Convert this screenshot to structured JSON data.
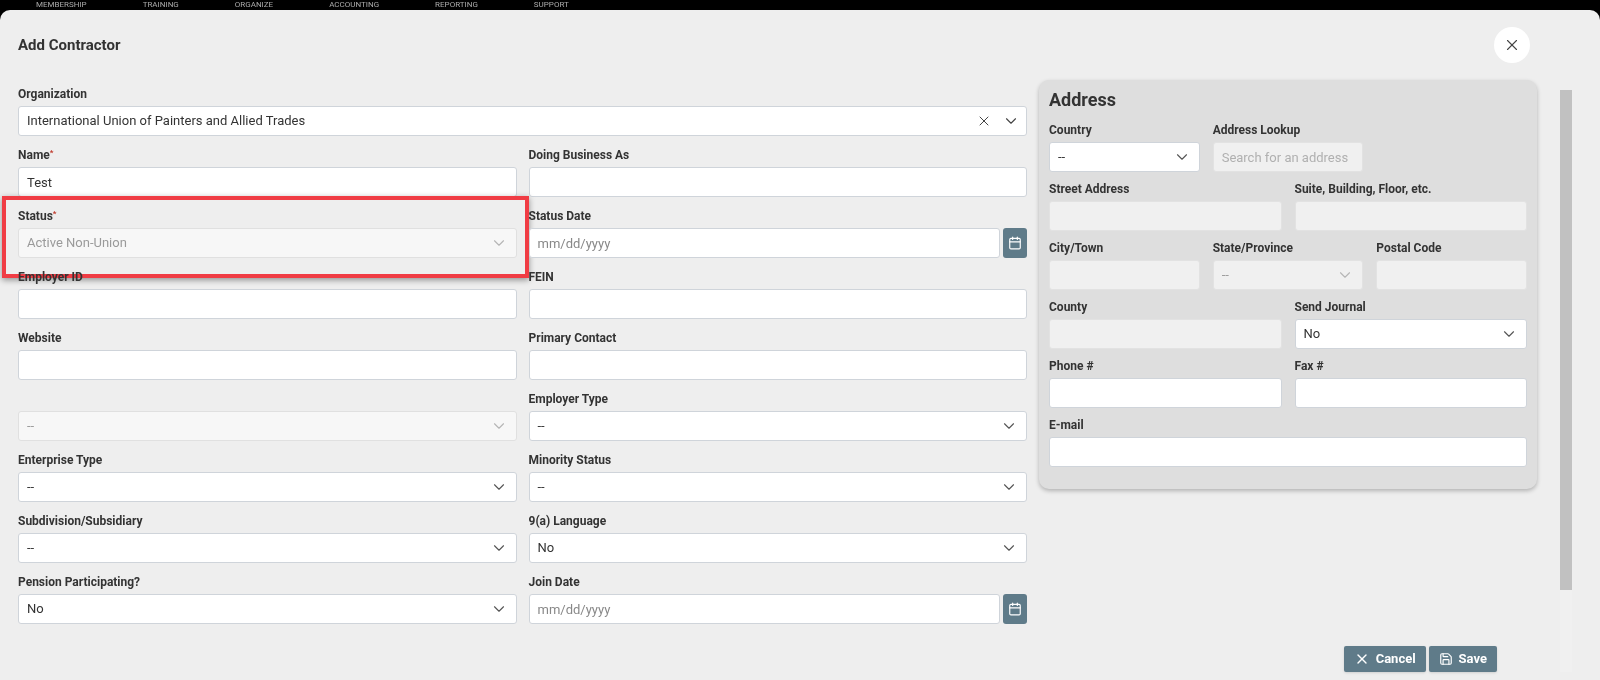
{
  "nav": [
    "MEMBERSHIP",
    "TRAINING",
    "ORGANIZE",
    "ACCOUNTING",
    "REPORTING",
    "SUPPORT"
  ],
  "dialog": {
    "title": "Add Contractor"
  },
  "organization": {
    "label": "Organization",
    "value": "International Union of Painters and Allied Trades"
  },
  "fields": [
    {
      "label": "Name",
      "required_mark": "*",
      "kind": "text",
      "value": "Test",
      "disabled": false
    },
    {
      "label": "Doing Business As",
      "kind": "text",
      "disabled": false
    },
    {
      "label": "Status",
      "required_mark": "*",
      "kind": "select",
      "value": "Active Non-Union",
      "disabled": true,
      "highlighted": true
    },
    {
      "label": "Status Date",
      "kind": "date",
      "placeholder": "mm/dd/yyyy",
      "disabled": false
    },
    {
      "label": "Employer ID",
      "kind": "text",
      "disabled": false
    },
    {
      "label": "FEIN",
      "kind": "text",
      "disabled": false
    },
    {
      "label": "Website",
      "kind": "text",
      "disabled": false
    },
    {
      "label": "Primary Contact",
      "kind": "text",
      "disabled": false
    },
    {
      "kind": "select",
      "value": "--",
      "disabled": true
    },
    {
      "label": "Employer Type",
      "kind": "select",
      "value": "--",
      "disabled": false
    },
    {
      "label": "Enterprise Type",
      "kind": "select",
      "value": "--",
      "disabled": false
    },
    {
      "label": "Minority Status",
      "kind": "select",
      "value": "--",
      "disabled": false
    },
    {
      "label": "Subdivision/Subsidiary",
      "kind": "select",
      "value": "--",
      "disabled": false
    },
    {
      "label": "9(a) Language",
      "kind": "select",
      "value": "No",
      "disabled": false
    },
    {
      "label": "Pension Participating?",
      "kind": "select",
      "value": "No",
      "disabled": false
    },
    {
      "label": "Join Date",
      "kind": "date",
      "placeholder": "mm/dd/yyyy",
      "disabled": false
    }
  ],
  "address": {
    "title": "Address",
    "rows": [
      [
        {
          "label": "Country",
          "kind": "select",
          "value": "--",
          "disabled": false
        },
        {
          "label": "Address Lookup",
          "kind": "text",
          "placeholder": "Search for an address",
          "disabled": true
        }
      ],
      [
        {
          "label": "Street Address",
          "kind": "text",
          "disabled": true
        },
        {
          "label": "Suite, Building, Floor, etc.",
          "kind": "text",
          "disabled": true
        }
      ],
      [
        {
          "label": "City/Town",
          "kind": "text",
          "disabled": true
        },
        {
          "label": "State/Province",
          "kind": "select",
          "value": "--",
          "disabled": true
        },
        {
          "label": "Postal Code",
          "kind": "text",
          "disabled": true
        }
      ],
      [
        {
          "label": "County",
          "kind": "text",
          "disabled": true
        },
        {
          "label": "Send Journal",
          "kind": "select",
          "value": "No",
          "disabled": false
        }
      ],
      [
        {
          "label": "Phone #",
          "kind": "text",
          "disabled": false
        },
        {
          "label": "Fax #",
          "kind": "text",
          "disabled": false
        }
      ],
      [
        {
          "label": "E-mail",
          "kind": "text",
          "disabled": false
        }
      ]
    ]
  },
  "buttons": [
    {
      "label": "Cancel",
      "kind": "cancel"
    },
    {
      "label": "Save",
      "kind": "save"
    }
  ]
}
